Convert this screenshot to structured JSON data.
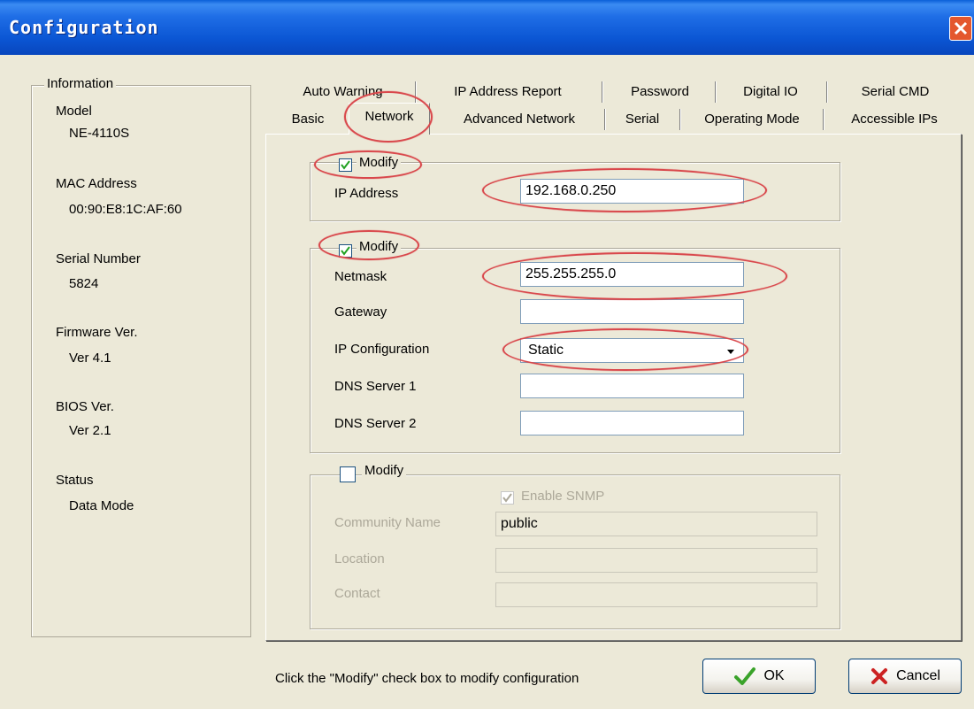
{
  "window": {
    "title": "Configuration"
  },
  "info": {
    "legend": "Information",
    "model_label": "Model",
    "model_value": "NE-4110S",
    "mac_label": "MAC Address",
    "mac_value": "00:90:E8:1C:AF:60",
    "serial_label": "Serial Number",
    "serial_value": "5824",
    "firmware_label": "Firmware Ver.",
    "firmware_value": "Ver 4.1",
    "bios_label": "BIOS Ver.",
    "bios_value": "Ver 2.1",
    "status_label": "Status",
    "status_value": "Data Mode"
  },
  "tabs": {
    "row1": [
      "Auto Warning",
      "IP Address Report",
      "Password",
      "Digital IO",
      "Serial CMD"
    ],
    "row2": [
      "Basic",
      "Network",
      "Advanced Network",
      "Serial",
      "Operating Mode",
      "Accessible IPs"
    ],
    "active": "Network"
  },
  "ip_group": {
    "modify_label": "Modify",
    "modify_checked": true,
    "ip_label": "IP Address",
    "ip_value": "192.168.0.250"
  },
  "net_group": {
    "modify_label": "Modify",
    "modify_checked": true,
    "netmask_label": "Netmask",
    "netmask_value": "255.255.255.0",
    "gateway_label": "Gateway",
    "gateway_value": "",
    "ipconfig_label": "IP Configuration",
    "ipconfig_value": "Static",
    "dns1_label": "DNS Server 1",
    "dns1_value": "",
    "dns2_label": "DNS Server 2",
    "dns2_value": ""
  },
  "snmp_group": {
    "modify_label": "Modify",
    "modify_checked": false,
    "enable_label": "Enable SNMP",
    "enable_checked": true,
    "community_label": "Community Name",
    "community_value": "public",
    "location_label": "Location",
    "location_value": "",
    "contact_label": "Contact",
    "contact_value": ""
  },
  "footer": {
    "hint": "Click the \"Modify\" check box to modify configuration",
    "ok_label": "OK",
    "cancel_label": "Cancel"
  },
  "colors": {
    "highlight": "#d9484c",
    "titlebar": "#0b56d4",
    "ok_icon": "#3aa32a",
    "cancel_icon": "#cc2222"
  },
  "icons": {
    "close": "close-icon",
    "ok": "check-icon",
    "cancel": "x-icon",
    "dropdown": "chevron-down-icon"
  }
}
